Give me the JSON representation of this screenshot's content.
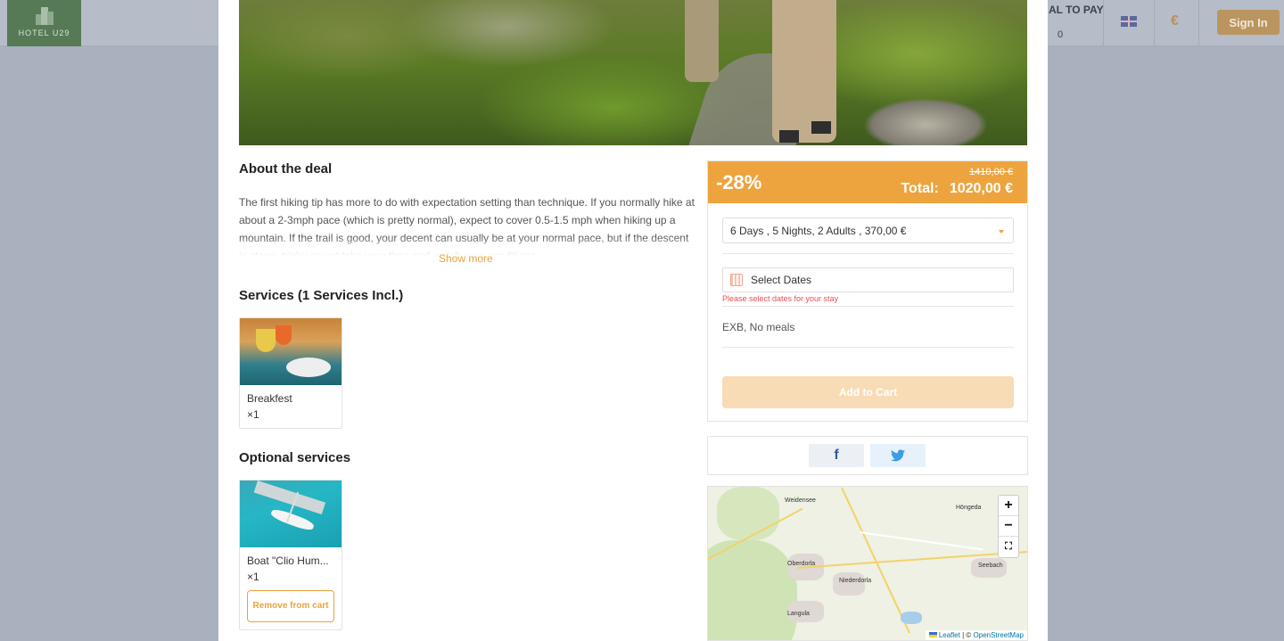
{
  "header": {
    "logo_text": "HOTEL U29",
    "to_pay_label": "AL TO PAY",
    "to_pay_value": "0",
    "currency_symbol": "€",
    "sign_in_label": "Sign In"
  },
  "deal": {
    "about_title": "About the deal",
    "about_text": "The first hiking tip has more to do with expectation setting than technique. If you normally hike at about a 2-3mph pace (which is pretty normal), expect to cover 0.5-1.5 mph when hiking up a mountain. If the trail is good, your decent can usually be at your normal pace, but if the descent is steep, tricky or wet take your time and watch your conditions.",
    "show_more_label": "Show more",
    "services_title": "Services (1 Services Incl.)",
    "services": [
      {
        "name": "Breakfest",
        "qty": "×1"
      }
    ],
    "optional_title": "Optional services",
    "optional": [
      {
        "name": "Boat \"Clio Hum...",
        "qty": "×1",
        "remove_label": "Remove from cart"
      }
    ]
  },
  "booking": {
    "discount": "-28%",
    "old_price": "1410,00 €",
    "total_label": "Total:",
    "total_value": "1020,00 €",
    "package_option": "6 Days , 5 Nights, 2 Adults , 370,00 €",
    "dates_placeholder": "Select Dates",
    "dates_error": "Please select dates for your stay",
    "board": "EXB, No meals",
    "add_to_cart_label": "Add to Cart",
    "accent_color": "#eda43e"
  },
  "share": {
    "facebook_glyph": "f",
    "twitter_icon": "twitter-bird-icon"
  },
  "map": {
    "places": [
      "Weidensee",
      "Höngeda",
      "Oberdorla",
      "Niederdorla",
      "Seebach",
      "Langula"
    ],
    "zoom_in": "+",
    "zoom_out": "−",
    "attribution_leaflet": "Leaflet",
    "attribution_sep": "| ©",
    "attribution_osm": "OpenStreetMap"
  }
}
